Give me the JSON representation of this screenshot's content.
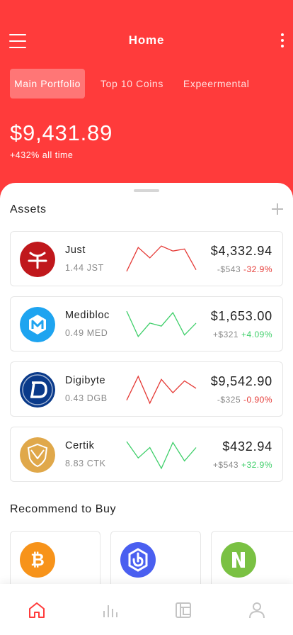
{
  "header": {
    "title": "Home",
    "tabs": [
      {
        "label": "Main Portfolio",
        "active": true
      },
      {
        "label": "Top 10 Coins",
        "active": false
      },
      {
        "label": "Expeermental",
        "active": false
      }
    ],
    "balance": "$9,431.89",
    "change": "+432% all time",
    "background_color": "#ff3b3b"
  },
  "assets_section": {
    "title": "Assets",
    "items": [
      {
        "name": "Just",
        "holding": "1.44 JST",
        "value": "$4,332.94",
        "delta_amount": "-$543",
        "delta_percent": "-32.9%",
        "trend": "down",
        "icon": "just-logo-icon",
        "icon_color": "#c0181c",
        "spark": [
          0.9,
          0.1,
          0.45,
          0.05,
          0.22,
          0.15,
          0.85
        ]
      },
      {
        "name": "Medibloc",
        "holding": "0.49 MED",
        "value": "$1,653.00",
        "delta_amount": "+$321",
        "delta_percent": "+4.09%",
        "trend": "up",
        "icon": "medibloc-logo-icon",
        "icon_color": "#1ea4f0",
        "spark": [
          0.05,
          0.9,
          0.45,
          0.55,
          0.1,
          0.85,
          0.45
        ]
      },
      {
        "name": "Digibyte",
        "holding": "0.43 DGB",
        "value": "$9,542.90",
        "delta_amount": "-$325",
        "delta_percent": "-0.90%",
        "trend": "down",
        "icon": "digibyte-logo-icon",
        "icon_color": "#0a3a8a",
        "spark": [
          0.85,
          0.05,
          0.95,
          0.15,
          0.6,
          0.2,
          0.45
        ]
      },
      {
        "name": "Certik",
        "holding": "8.83 CTK",
        "value": "$432.94",
        "delta_amount": "+$543",
        "delta_percent": "+32.9%",
        "trend": "up",
        "icon": "certik-logo-icon",
        "icon_color": "#e0a84a",
        "spark": [
          0.05,
          0.6,
          0.25,
          0.95,
          0.08,
          0.7,
          0.25
        ]
      }
    ]
  },
  "recommend_section": {
    "title": "Recommend to Buy",
    "items": [
      {
        "icon": "bitcoin-logo-icon",
        "icon_color": "#f7931a"
      },
      {
        "icon": "bounce-logo-icon",
        "icon_color": "#4a5ff0"
      },
      {
        "icon": "nuls-logo-icon",
        "icon_color": "#7ac143"
      }
    ]
  },
  "bottom_nav": {
    "items": [
      {
        "icon": "home-icon",
        "active": true
      },
      {
        "icon": "bar-chart-icon",
        "active": false
      },
      {
        "icon": "wallet-icon",
        "active": false
      },
      {
        "icon": "profile-icon",
        "active": false
      }
    ],
    "active_color": "#ff3b3b",
    "inactive_color": "#c4c4c4"
  }
}
